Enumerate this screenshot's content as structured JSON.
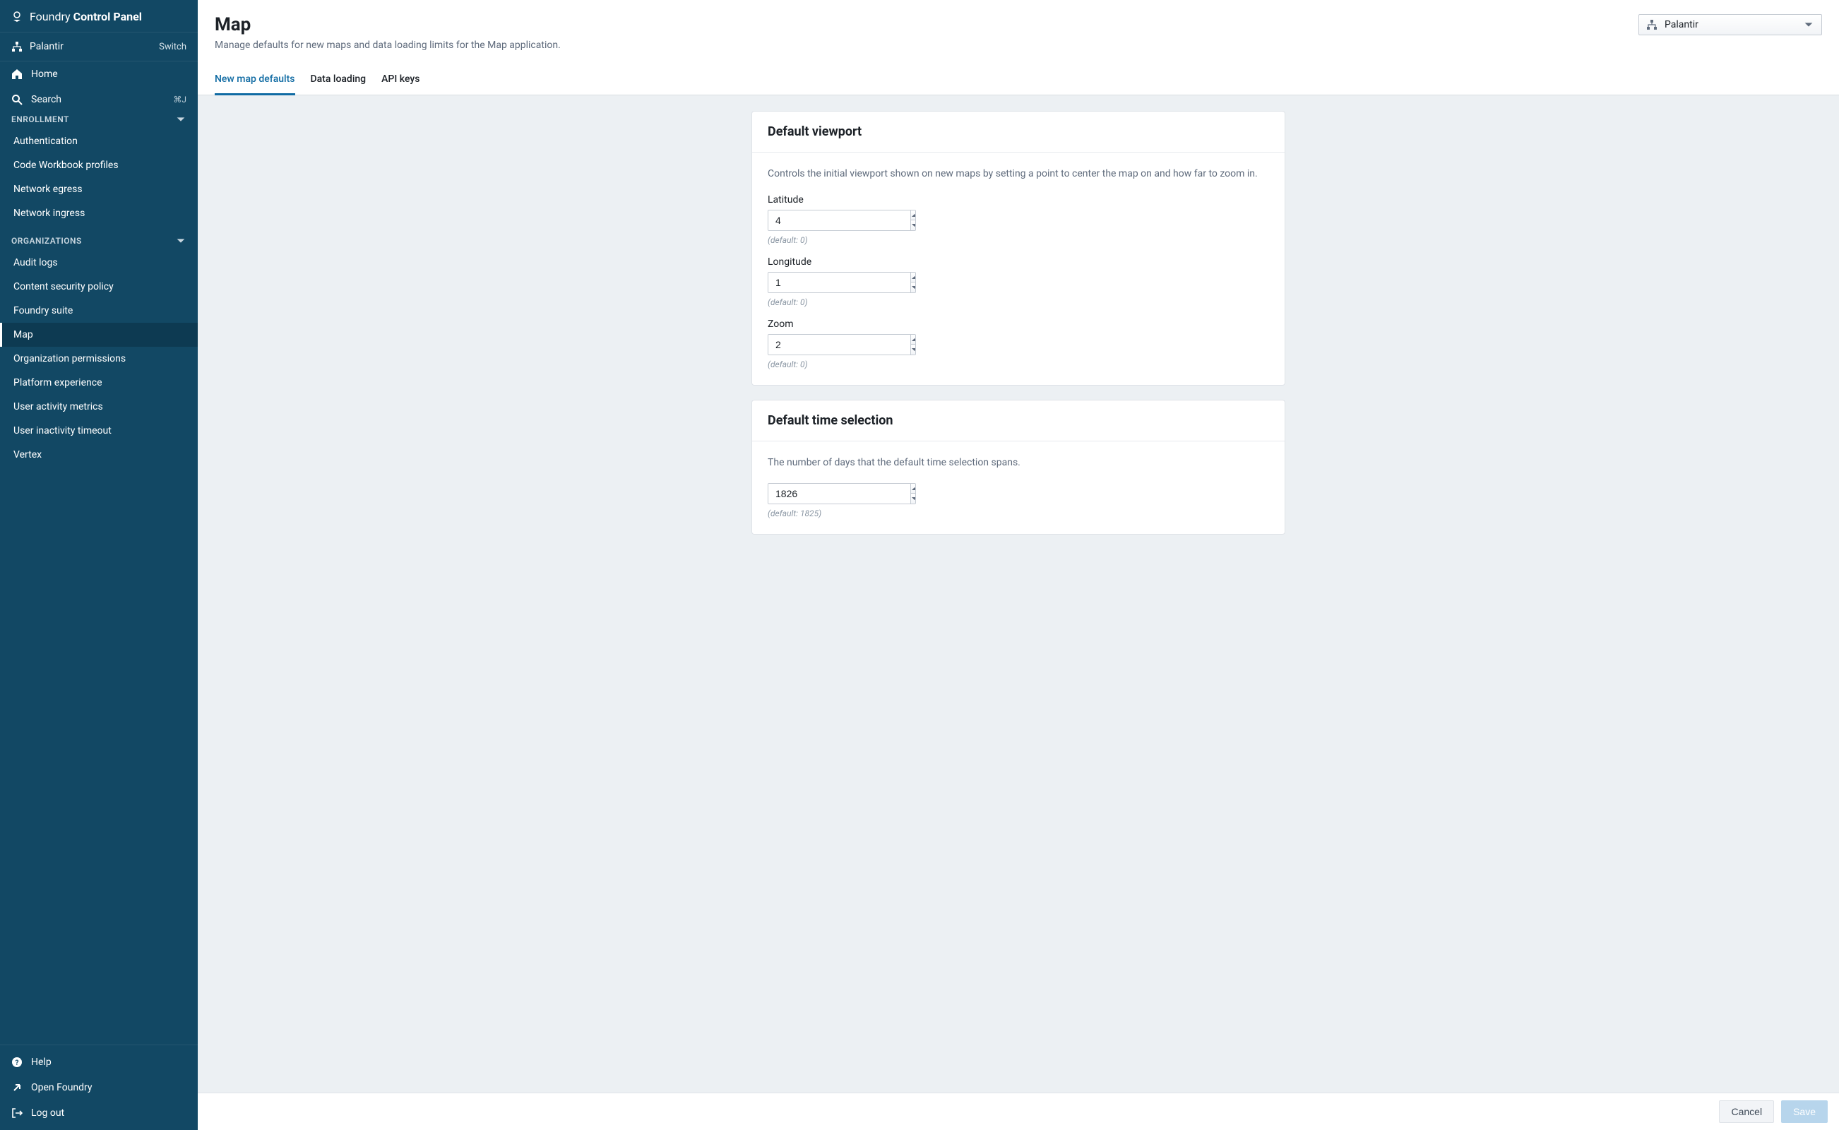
{
  "brand": {
    "first": "Foundry",
    "second": "Control Panel"
  },
  "org": {
    "name": "Palantir",
    "switch": "Switch"
  },
  "nav": {
    "home": "Home",
    "search": "Search",
    "search_shortcut": "⌘J"
  },
  "sections": {
    "enrollment_label": "ENROLLMENT",
    "enrollment_items": [
      "Authentication",
      "Code Workbook profiles",
      "Network egress",
      "Network ingress"
    ],
    "orgs_label": "ORGANIZATIONS",
    "orgs_items": [
      "Audit logs",
      "Content security policy",
      "Foundry suite",
      "Map",
      "Organization permissions",
      "Platform experience",
      "User activity metrics",
      "User inactivity timeout",
      "Vertex"
    ],
    "active_item": "Map"
  },
  "bottom_nav": {
    "help": "Help",
    "open_foundry": "Open Foundry",
    "log_out": "Log out"
  },
  "page": {
    "title": "Map",
    "subtitle": "Manage defaults for new maps and data loading limits for the Map application.",
    "org_selector": "Palantir"
  },
  "tabs": [
    "New map defaults",
    "Data loading",
    "API keys"
  ],
  "active_tab": "New map defaults",
  "cards": {
    "viewport": {
      "title": "Default viewport",
      "desc": "Controls the initial viewport shown on new maps by setting a point to center the map on and how far to zoom in.",
      "lat_label": "Latitude",
      "lat_value": "4",
      "lat_hint": "(default: 0)",
      "lon_label": "Longitude",
      "lon_value": "1",
      "lon_hint": "(default: 0)",
      "zoom_label": "Zoom",
      "zoom_value": "2",
      "zoom_hint": "(default: 0)"
    },
    "time": {
      "title": "Default time selection",
      "desc": "The number of days that the default time selection spans.",
      "days_value": "1826",
      "days_hint": "(default: 1825)"
    }
  },
  "footer": {
    "cancel": "Cancel",
    "save": "Save"
  }
}
